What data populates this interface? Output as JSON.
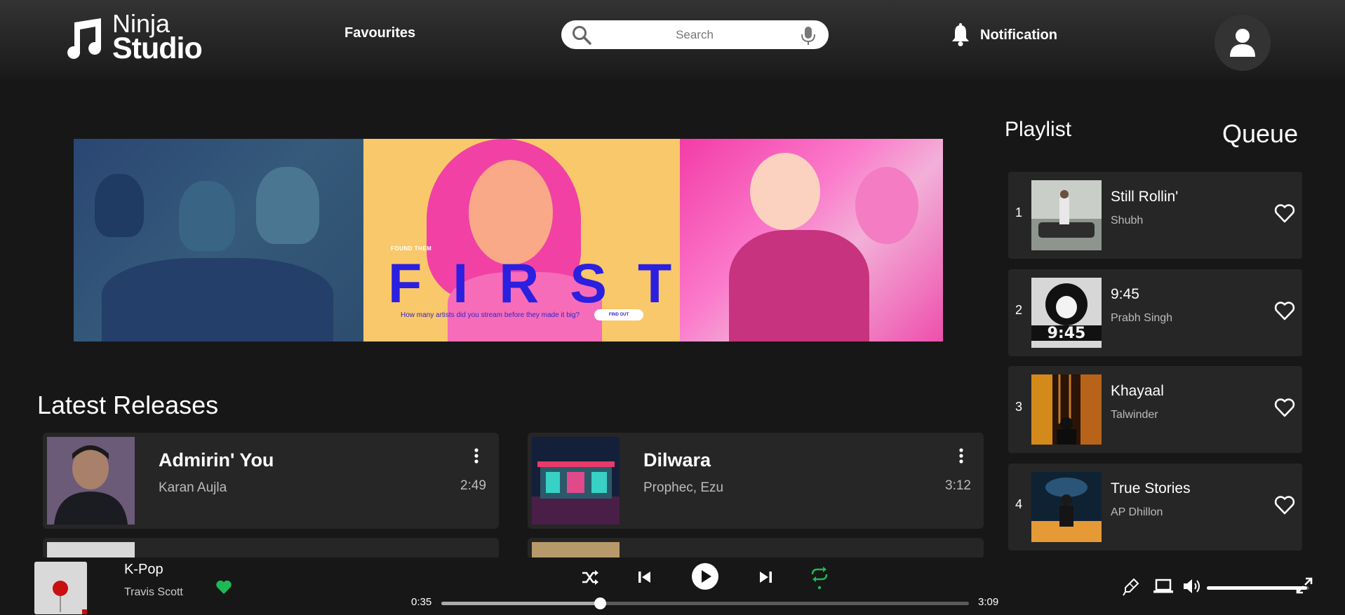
{
  "header": {
    "logo_line1": "Ninja",
    "logo_line2": "Studio",
    "favourites_label": "Favourites",
    "search_placeholder": "Search",
    "notification_label": "Notification"
  },
  "banner": {
    "found_them": "FOUND THEM",
    "headline": "FIRST",
    "question": "How many artists did you stream before they made it big?",
    "button_label": "FIND OUT"
  },
  "latest": {
    "title": "Latest Releases",
    "items": [
      {
        "title": "Admirin' You",
        "artist": "Karan Aujla",
        "duration": "2:49"
      },
      {
        "title": "Dilwara",
        "artist": "Prophec, Ezu",
        "duration": "3:12"
      }
    ]
  },
  "sidebar": {
    "playlist_tab": "Playlist",
    "queue_tab": "Queue",
    "items": [
      {
        "num": "1",
        "title": "Still Rollin'",
        "artist": "Shubh"
      },
      {
        "num": "2",
        "title": "9:45",
        "artist": "Prabh Singh"
      },
      {
        "num": "3",
        "title": "Khayaal",
        "artist": "Talwinder"
      },
      {
        "num": "4",
        "title": "True Stories",
        "artist": "AP Dhillon"
      }
    ]
  },
  "player": {
    "title": "K-Pop",
    "artist": "Travis Scott",
    "current_time": "0:35",
    "total_time": "3:09",
    "progress": 0.3,
    "volume": 0.98,
    "liked": true,
    "accent_color": "#1db954"
  },
  "icons": [
    "music-note-icon",
    "search-icon",
    "mic-icon",
    "bell-icon",
    "user-icon",
    "dots-icon",
    "heart-icon",
    "shuffle-icon",
    "previous-icon",
    "play-icon",
    "next-icon",
    "repeat-icon",
    "microphone-icon",
    "device-icon",
    "volume-icon",
    "expand-icon"
  ]
}
